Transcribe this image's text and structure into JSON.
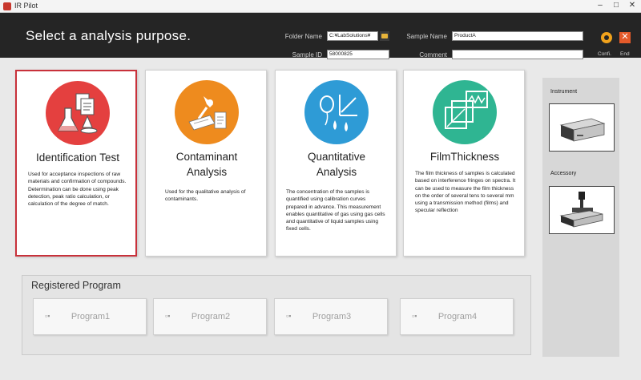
{
  "window": {
    "title": "IR Pilot",
    "min_glyph": "–",
    "max_glyph": "□",
    "close_glyph": "✕"
  },
  "header": {
    "prompt": "Select a analysis purpose.",
    "folder_name_label": "Folder Name",
    "folder_name_value": "C:¥LabSolutions¥",
    "sample_id_label": "Sample ID",
    "sample_id_value": "58000825",
    "sample_name_label": "Sample Name",
    "sample_name_value": "ProductA",
    "comment_label": "Comment",
    "comment_value": "",
    "conf_label": "Confi.",
    "end_label": "End",
    "end_glyph": "✕"
  },
  "cards": [
    {
      "title": "Identification Test",
      "desc": "Used for acceptance inspections of raw materials and confirmation of compounds. Determination can be done using peak detection, peak ratio calculation, or calculation of the degree of match.",
      "color": "#e4403f",
      "selected": true
    },
    {
      "title_line1": "Contaminant",
      "title_line2": "Analysis",
      "desc": "Used for the qualitative analysis of contaminants.",
      "color": "#ee8b1e"
    },
    {
      "title_line1": "Quantitative",
      "title_line2": "Analysis",
      "desc": "The concentration of the samples is quantified using calibration curves prepared in advance. This measurement enables quantitative of gas using gas cells and quantitative of liquid samples using fixed cells.",
      "color": "#2e9bd6"
    },
    {
      "title": "FilmThickness",
      "desc": "The film thickness of samples is calculated based on interference fringes on spectra. It can be used to measure the film thickness on the order of several tens to several mm using a transmission method (films) and specular reflection",
      "color": "#2fb592"
    }
  ],
  "registered": {
    "title": "Registered Program",
    "programs": [
      "Program1",
      "Program2",
      "Program3",
      "Program4"
    ],
    "glyph": "▫▪"
  },
  "side": {
    "instrument_label": "Instrument",
    "accessory_label": "Accessory"
  }
}
